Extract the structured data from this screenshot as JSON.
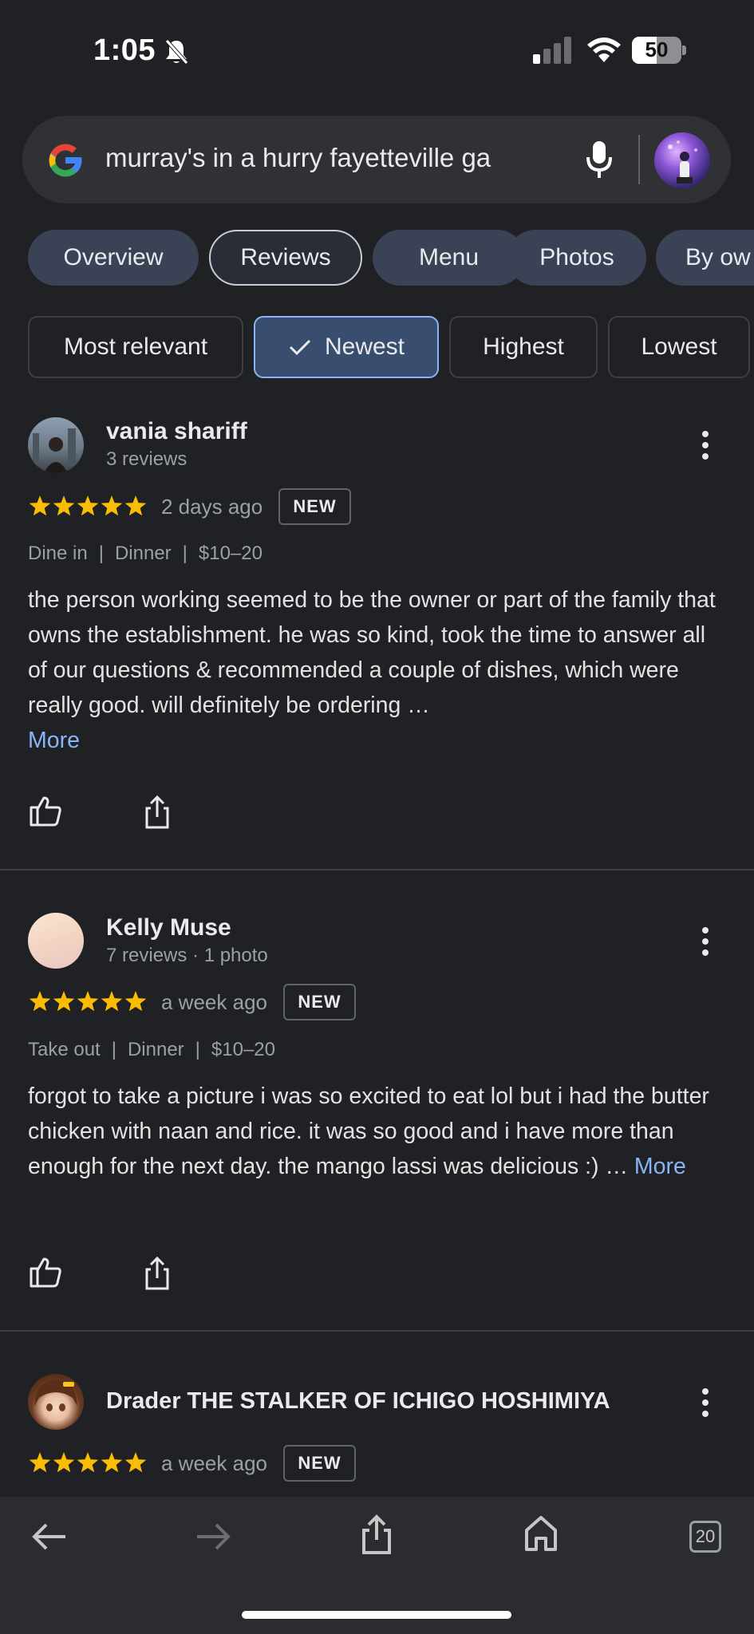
{
  "status_bar": {
    "time": "1:05",
    "battery": "50",
    "battery_level": 0.5
  },
  "search": {
    "query": "murray's in a hurry fayetteville ga"
  },
  "tabs": [
    {
      "label": "Overview"
    },
    {
      "label": "Reviews",
      "active": true
    },
    {
      "label": "Menu"
    },
    {
      "label": "Photos"
    },
    {
      "label": "By ow"
    }
  ],
  "filters": [
    {
      "label": "Most relevant"
    },
    {
      "label": "Newest",
      "active": true
    },
    {
      "label": "Highest"
    },
    {
      "label": "Lowest"
    }
  ],
  "reviews": [
    {
      "name": "vania shariff",
      "sub": "3 reviews",
      "rating": 5,
      "time": "2 days ago",
      "badge": "NEW",
      "meta": [
        "Dine in",
        "Dinner",
        "$10–20"
      ],
      "text": "the person working seemed to be the owner or part of the family that owns the establishment. he was so kind, took the time to answer all of our questions & recommended a couple of dishes, which were really good. will definitely be ordering …",
      "more": "More"
    },
    {
      "name": "Kelly Muse",
      "sub": "7 reviews · 1 photo",
      "rating": 5,
      "time": "a week ago",
      "badge": "NEW",
      "meta": [
        "Take out",
        "Dinner",
        "$10–20"
      ],
      "text": "forgot to take a picture i was so excited to eat lol but i had the butter chicken with naan and rice. it was so good and i have more than enough for the next day. the mango lassi was delicious :) … ",
      "more": "More"
    },
    {
      "name": "Drader THE STALKER OF ICHIGO HOSHIMIYA",
      "rating": 5,
      "time": "a week ago",
      "badge": "NEW"
    }
  ],
  "toolbar": {
    "tab_count": "20"
  },
  "colors": {
    "background": "#202124",
    "star": "#fbbc04",
    "link": "#8ab4f8",
    "active_filter": "#394d6f"
  }
}
